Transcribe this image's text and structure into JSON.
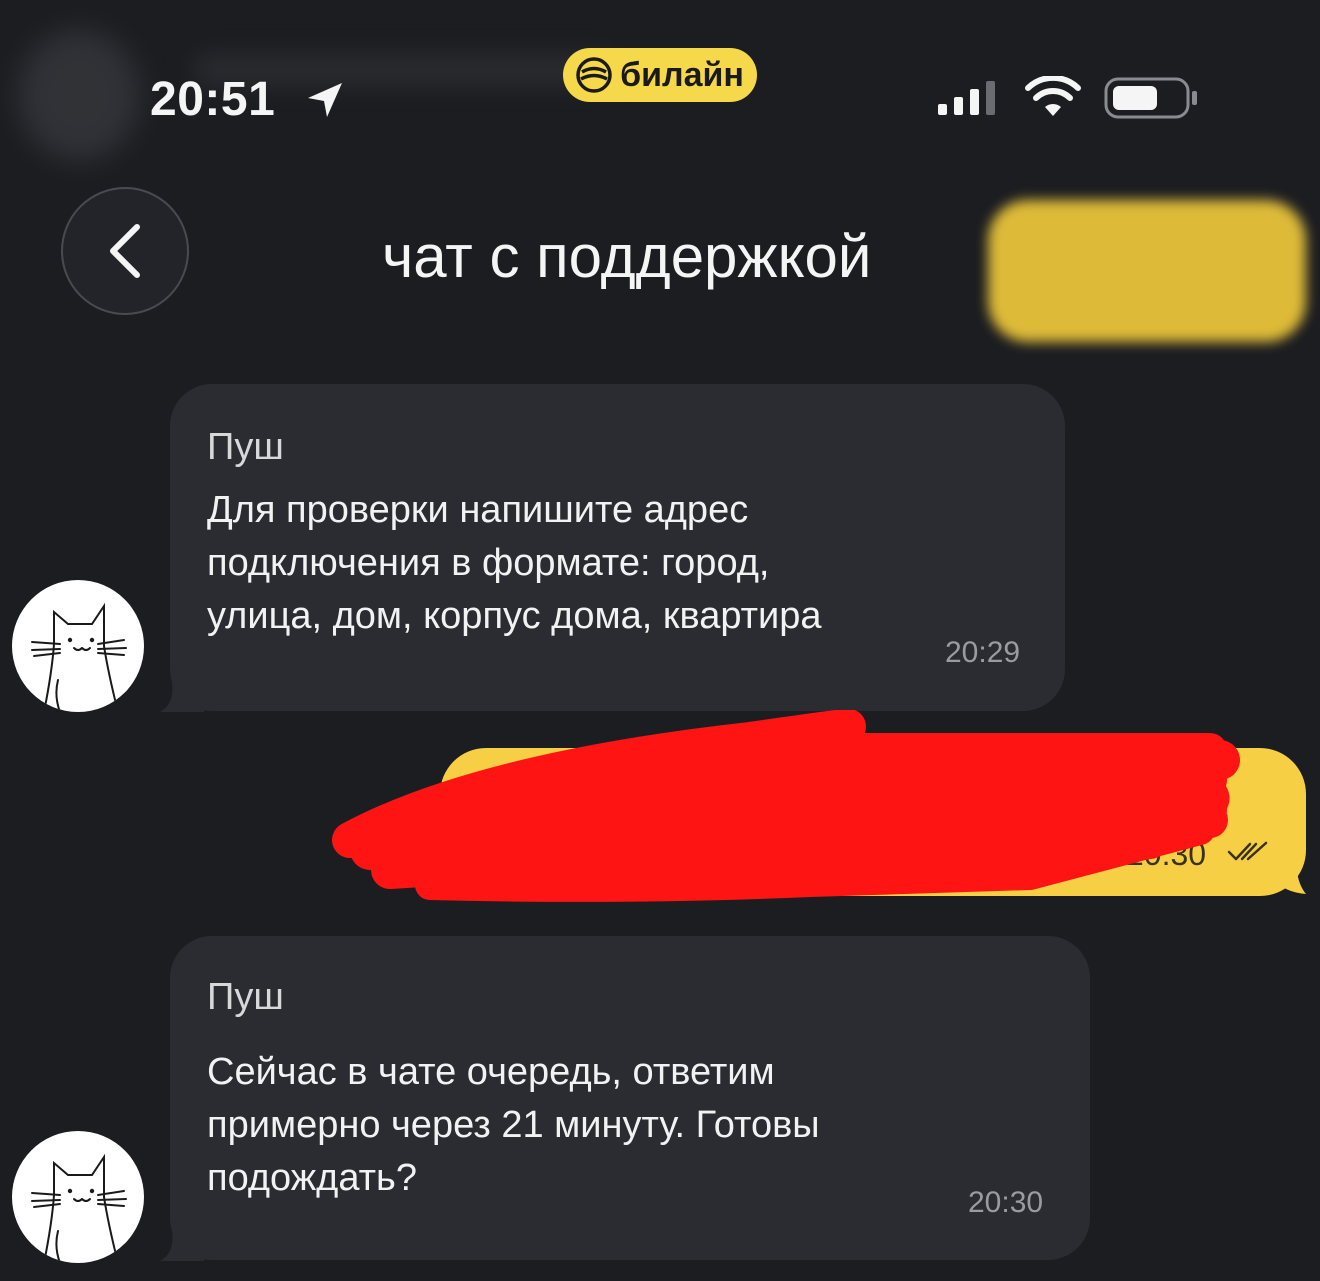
{
  "status_bar": {
    "time": "20:51",
    "carrier": "билайн",
    "icons": [
      "location-arrow-icon",
      "signal-icon",
      "wifi-icon",
      "battery-icon"
    ]
  },
  "header": {
    "title": "чат с поддержкой",
    "back_icon": "chevron-left-icon"
  },
  "messages": [
    {
      "sender": "Пуш",
      "text": "Для проверки напишите адрес\nподключения в формате: город,\nулица, дом, корпус дома, квартира",
      "time": "20:29"
    },
    {
      "outgoing": true,
      "time": "20:30",
      "redacted": true
    },
    {
      "sender": "Пуш",
      "text": "Сейчас в чате очередь, ответим\nпримерно через 21 минуту. Готовы\nподождать?",
      "time": "20:30"
    }
  ],
  "colors": {
    "background": "#1c1d21",
    "incoming_bubble": "#2a2c32",
    "outgoing_bubble": "#f6cf44",
    "carrier_badge": "#f6d94a",
    "redaction": "#ff1414"
  }
}
